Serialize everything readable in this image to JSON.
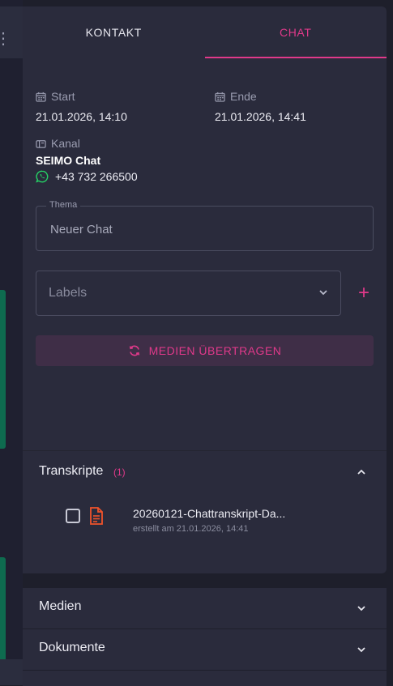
{
  "tabs": [
    {
      "label": "KONTAKT",
      "active": false
    },
    {
      "label": "CHAT",
      "active": true
    }
  ],
  "info": {
    "start_label": "Start",
    "start_value": "21.01.2026, 14:10",
    "end_label": "Ende",
    "end_value": "21.01.2026, 14:41",
    "kanal_label": "Kanal",
    "kanal_name": "SEIMO Chat",
    "phone": "+43 732 266500"
  },
  "thema": {
    "legend": "Thema",
    "value": "Neuer Chat"
  },
  "labels": {
    "placeholder": "Labels",
    "add": "+"
  },
  "medien_button": "MEDIEN ÜBERTRAGEN",
  "transkripte": {
    "title": "Transkripte",
    "count": "(1)",
    "items": [
      {
        "name": "20260121-Chattranskript-Da...",
        "meta": "erstellt am 21.01.2026, 14:41"
      }
    ]
  },
  "medien": {
    "title": "Medien"
  },
  "dokumente": {
    "title": "Dokumente"
  },
  "colors": {
    "accent": "#e0398a",
    "panel": "#2a2b3c",
    "background": "#1e1f2b",
    "whatsapp": "#25d366",
    "file_icon": "#f0532b"
  }
}
